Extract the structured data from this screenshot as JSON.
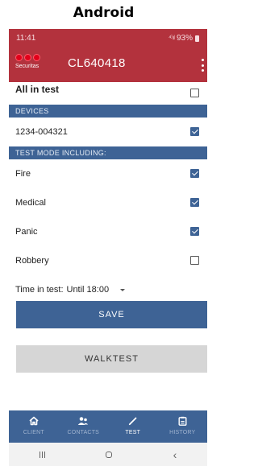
{
  "caption": "Android",
  "status_bar": {
    "time": "11:41",
    "signal": "⁴ᴳ.ıl",
    "battery": "93%"
  },
  "app_bar": {
    "logo_text": "Securitas",
    "title": "CL640418"
  },
  "all_in_test": {
    "label": "All in test",
    "checked": false
  },
  "devices": {
    "header": "DEVICES",
    "items": [
      {
        "label": "1234-004321",
        "checked": true
      }
    ]
  },
  "test_mode": {
    "header": "TEST MODE INCLUDING:",
    "items": [
      {
        "label": "Fire",
        "checked": true
      },
      {
        "label": "Medical",
        "checked": true
      },
      {
        "label": "Panic",
        "checked": true
      },
      {
        "label": "Robbery",
        "checked": false
      }
    ]
  },
  "time_in_test": {
    "label": "Time in test:",
    "value": "Until 18:00"
  },
  "buttons": {
    "save": "SAVE",
    "walktest": "WALKTEST"
  },
  "bottom_nav": [
    {
      "label": "CLIENT",
      "icon": "home-icon",
      "active": false
    },
    {
      "label": "CONTACTS",
      "icon": "contacts-icon",
      "active": false
    },
    {
      "label": "TEST",
      "icon": "test-icon",
      "active": true
    },
    {
      "label": "HISTORY",
      "icon": "history-icon",
      "active": false
    }
  ],
  "colors": {
    "brand_red": "#b3323d",
    "accent_blue": "#3e6395",
    "button_gray": "#d6d6d6"
  }
}
